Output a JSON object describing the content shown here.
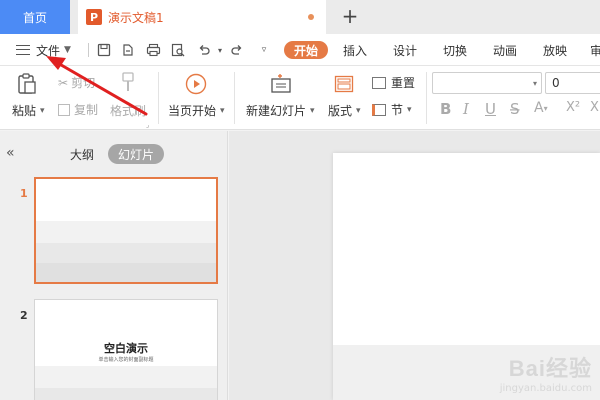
{
  "tabs": {
    "home": "首页",
    "document": "演示文稿1"
  },
  "menu": {
    "file": "文件",
    "tabs": [
      "开始",
      "插入",
      "设计",
      "切换",
      "动画",
      "放映",
      "审"
    ]
  },
  "ribbon": {
    "paste": "粘贴",
    "cut": "剪切",
    "copy": "复制",
    "format_painter": "格式刷",
    "play_from_current": "当页开始",
    "new_slide": "新建幻灯片",
    "layout": "版式",
    "reset": "重置",
    "section": "节",
    "font_size": "0"
  },
  "sidebar": {
    "views": [
      "大纲",
      "幻灯片"
    ],
    "slides": [
      {
        "number": "1"
      },
      {
        "number": "2",
        "title": "空白演示",
        "subtitle": "单击输入您的封面副标题"
      }
    ]
  },
  "watermark": {
    "logo": "Bai经验",
    "url": "jingyan.baidu.com"
  },
  "colors": {
    "accent": "#e57a45",
    "home_tab": "#4c8bf5",
    "arrow": "#e02020"
  }
}
